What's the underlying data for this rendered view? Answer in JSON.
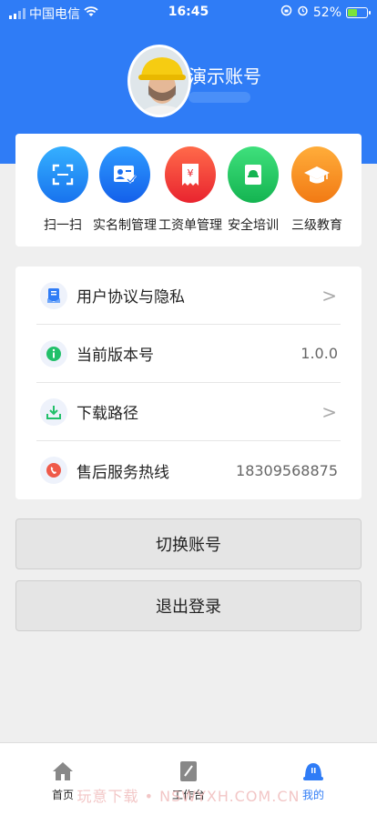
{
  "status": {
    "carrier": "中国电信",
    "time": "16:45",
    "battery": "52%"
  },
  "profile": {
    "name": "演示账号"
  },
  "quick_actions": [
    {
      "label": "扫一扫",
      "icon": "scan-icon",
      "color": "#1a8cf0"
    },
    {
      "label": "实名制管理",
      "icon": "id-card-icon",
      "color": "#1a6ff0"
    },
    {
      "label": "工资单管理",
      "icon": "payroll-icon",
      "color": "#f4433c"
    },
    {
      "label": "安全培训",
      "icon": "safety-book-icon",
      "color": "#1ec45f"
    },
    {
      "label": "三级教育",
      "icon": "graduation-cap-icon",
      "color": "#f7901e"
    }
  ],
  "settings": [
    {
      "label": "用户协议与隐私",
      "value": "",
      "arrow": ">"
    },
    {
      "label": "当前版本号",
      "value": "1.0.0",
      "arrow": ""
    },
    {
      "label": "下载路径",
      "value": "",
      "arrow": ">"
    },
    {
      "label": "售后服务热线",
      "value": "18309568875",
      "arrow": ""
    }
  ],
  "buttons": {
    "switch": "切换账号",
    "logout": "退出登录"
  },
  "tabs": [
    {
      "label": "首页",
      "active": false
    },
    {
      "label": "工作台",
      "active": false
    },
    {
      "label": "我的",
      "active": true
    }
  ],
  "watermark": "玩意下载 • NSWYXH.COM.CN",
  "colors": {
    "primary": "#2f7cf6",
    "background": "#efefef"
  }
}
